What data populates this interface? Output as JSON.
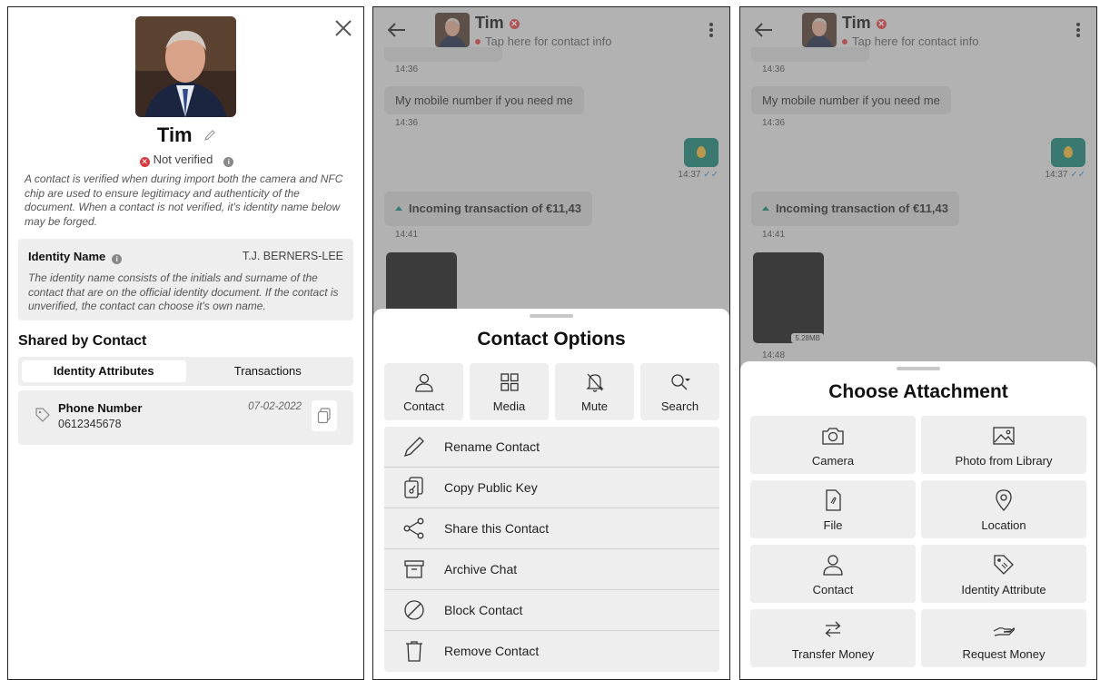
{
  "profile": {
    "name": "Tim",
    "status": "Not verified",
    "description": "A contact is verified when during import both the camera and NFC chip are used to ensure legitimacy and authenticity of the document. When a contact is not verified, it's identity name below may be forged.",
    "identity_label": "Identity Name",
    "identity_value": "T.J. BERNERS-LEE",
    "identity_description": "The identity name consists of the initials and surname of the contact that are on the official identity document. If the contact is unverified, the contact can choose it's own name.",
    "shared_title": "Shared by Contact",
    "tabs": [
      "Identity Attributes",
      "Transactions"
    ],
    "attribute": {
      "name": "Phone Number",
      "value": "0612345678",
      "date": "07-02-2022"
    }
  },
  "chat": {
    "contact_name": "Tim",
    "subtitle": "Tap here for contact info",
    "messages": {
      "time1": "14:36",
      "text": "My mobile number if you need me",
      "time2": "14:36",
      "time3": "14:37",
      "transaction": "Incoming transaction of €11,43",
      "time4": "14:41",
      "image_size": "5.28MB",
      "time5": "14:48"
    }
  },
  "contact_options": {
    "title": "Contact Options",
    "tiles": [
      "Contact",
      "Media",
      "Mute",
      "Search"
    ],
    "rows": [
      "Rename Contact",
      "Copy Public Key",
      "Share this Contact",
      "Archive Chat",
      "Block Contact",
      "Remove Contact"
    ]
  },
  "attachment": {
    "title": "Choose Attachment",
    "tiles": [
      "Camera",
      "Photo from Library",
      "File",
      "Location",
      "Contact",
      "Identity Attribute",
      "Transfer Money",
      "Request Money"
    ]
  },
  "colors": {
    "accent_green": "#0e7a6a",
    "unverified_red": "#d9393c",
    "tile_gray": "#eeeeee"
  }
}
